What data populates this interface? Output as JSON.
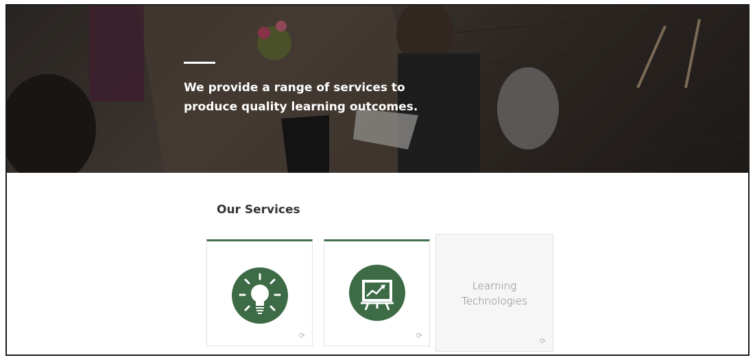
{
  "hero": {
    "headline_line1": "We provide a range of services to",
    "headline_line2": "produce quality learning outcomes."
  },
  "services": {
    "title": "Our Services",
    "cards": [
      {
        "icon": "lightbulb-icon",
        "active": true
      },
      {
        "icon": "presentation-chart-icon",
        "active": true
      },
      {
        "label_line1": "Learning",
        "label_line2": "Technologies",
        "active": false
      }
    ],
    "refresh_glyph": "⟳"
  },
  "colors": {
    "accent_green": "#3d6b46",
    "card_border": "#e1e1e1"
  }
}
